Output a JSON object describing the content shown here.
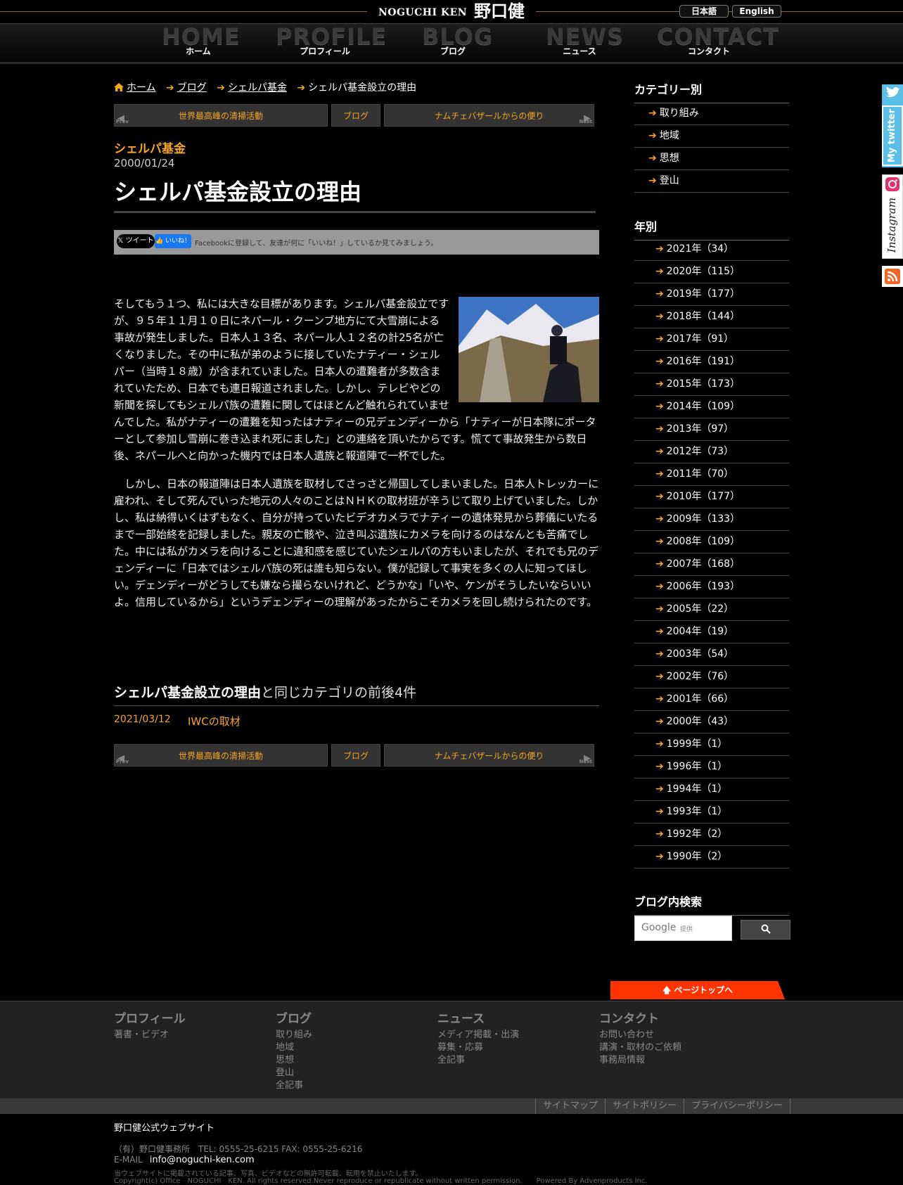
{
  "header": {
    "logo_en": "NOGUCHI KEN",
    "logo_ja": "野口健",
    "lang_ja": "日本語",
    "lang_en": "English"
  },
  "nav": [
    {
      "big": "HOME",
      "small": "ホーム"
    },
    {
      "big": "PROFILE",
      "small": "プロフィール"
    },
    {
      "big": "BLOG",
      "small": "ブログ"
    },
    {
      "big": "NEWS",
      "small": "ニュース"
    },
    {
      "big": "CONTACT",
      "small": "コンタクト"
    }
  ],
  "breadcrumb": [
    "ホーム",
    "ブログ",
    "シェルパ基金",
    "シェルパ基金設立の理由"
  ],
  "pager": {
    "prev_label": "Prev",
    "prev": "世界最高峰の清掃活動",
    "center": "ブログ",
    "next": "ナムチェバザールからの便り",
    "next_label": "Next"
  },
  "post": {
    "category": "シェルパ基金",
    "date": "2000/01/24",
    "title": "シェルパ基金設立の理由",
    "tweet": "ツイート",
    "like": "いいね！",
    "fb_note": "Facebookに登録して、友達が何に「いいね！」しているか見てみましょう。",
    "paragraph1": "そしてもう１つ、私には大きな目標があります。シェルパ基金設立ですが、９５年１１月１０日にネパール・クーンブ地方にて大雪崩による事故が発生しました。日本人１３名、ネパール人１２名の計25名が亡くなりました。その中に私が弟のように接していたナティー・シェルパー（当時１８歳）が含まれていました。日本人の遭難者が多数含まれていたため、日本でも連日報道されました。しかし、テレビやどの新聞を探してもシェルパ族の遭難に関してはほとんど触れられていませんでした。私がナティーの遭難を知ったはナティーの兄デェンディーから「ナティーが日本隊にポーターとして参加し雪崩に巻き込まれ死にました」との連絡を頂いたからです。慌てて事故発生から数日後、ネパールへと向かった機内では日本人遺族と報道陣で一杯でした。",
    "paragraph2": "　しかし、日本の報道陣は日本人遺族を取材してさっさと帰国してしまいました。日本人トレッカーに雇われ、そして死んでいった地元の人々のことはＮＨＫの取材班が辛うじて取り上げていました。しかし、私は納得いくはずもなく、自分が持っていたビデオカメラでナティーの遺体発見から葬儀にいたるまで一部始終を記録しました。親友の亡骸や、泣き叫ぶ遺族にカメラを向けるのはなんとも苦痛でした。中には私がカメラを向けることに違和感を感じていたシェルパの方もいましたが、それでも兄のデェンディーに「日本ではシェルパ族の死は誰も知らない。僕が記録して事実を多くの人に知ってほしい。デェンディーがどうしても嫌なら撮らないけれど、どうかな」「いや、ケンがそうしたいならいいよ。信用しているから」というデェンディーの理解があったからこそカメラを回し続けられたのです。"
  },
  "related": {
    "title_bold": "シェルパ基金設立の理由",
    "title_rest": "と同じカテゴリの前後4件",
    "items": [
      {
        "date": "2021/03/12",
        "title": "IWCの取材"
      }
    ]
  },
  "sidebar": {
    "categories_heading": "カテゴリー別",
    "categories": [
      "取り組み",
      "地域",
      "思想",
      "登山"
    ],
    "years_heading": "年別",
    "years": [
      "2021年（34）",
      "2020年（115）",
      "2019年（177）",
      "2018年（144）",
      "2017年（91）",
      "2016年（191）",
      "2015年（173）",
      "2014年（109）",
      "2013年（97）",
      "2012年（73）",
      "2011年（70）",
      "2010年（177）",
      "2009年（133）",
      "2008年（109）",
      "2007年（168）",
      "2006年（193）",
      "2005年（22）",
      "2004年（19）",
      "2003年（54）",
      "2002年（76）",
      "2001年（66）",
      "2000年（43）",
      "1999年（1）",
      "1996年（1）",
      "1994年（1）",
      "1993年（1）",
      "1992年（2）",
      "1990年（2）"
    ],
    "search_heading": "ブログ内検索",
    "search_brand": "Google",
    "search_provided": "提供"
  },
  "social": {
    "twitter": "My twitter",
    "instagram": "Instagram"
  },
  "pagetop": "ページトップへ",
  "footer": {
    "cols": [
      {
        "heading": "プロフィール",
        "links": [
          "著書・ビデオ"
        ]
      },
      {
        "heading": "ブログ",
        "links": [
          "取り組み",
          "地域",
          "思想",
          "登山",
          "全記事"
        ]
      },
      {
        "heading": "ニュース",
        "links": [
          "メディア掲載・出演",
          "募集・応募",
          "全記事"
        ]
      },
      {
        "heading": "コンタクト",
        "links": [
          "お問い合わせ",
          "講演・取材のご依頼",
          "事務局情報"
        ]
      }
    ],
    "links": [
      "サイトマップ",
      "サイトポリシー",
      "プライバシーポリシー"
    ],
    "site_name": "野口健公式ウェブサイト",
    "office": "（有）野口健事務所　TEL: 0555-25-6215 FAX: 0555-25-6216",
    "email_label": "E-MAIL",
    "email": "info@noguchi-ken.com",
    "notice": "当ウェブサイトに掲載されている記事、写真、ビデオなどの無許可転載、転用を禁止いたします。",
    "copyright": "Copyright(c) Office　NOGUCHI　KEN. All rights reserved.Never reproduce or republicate without written permission.　　Powered By Advenproducts Inc."
  }
}
